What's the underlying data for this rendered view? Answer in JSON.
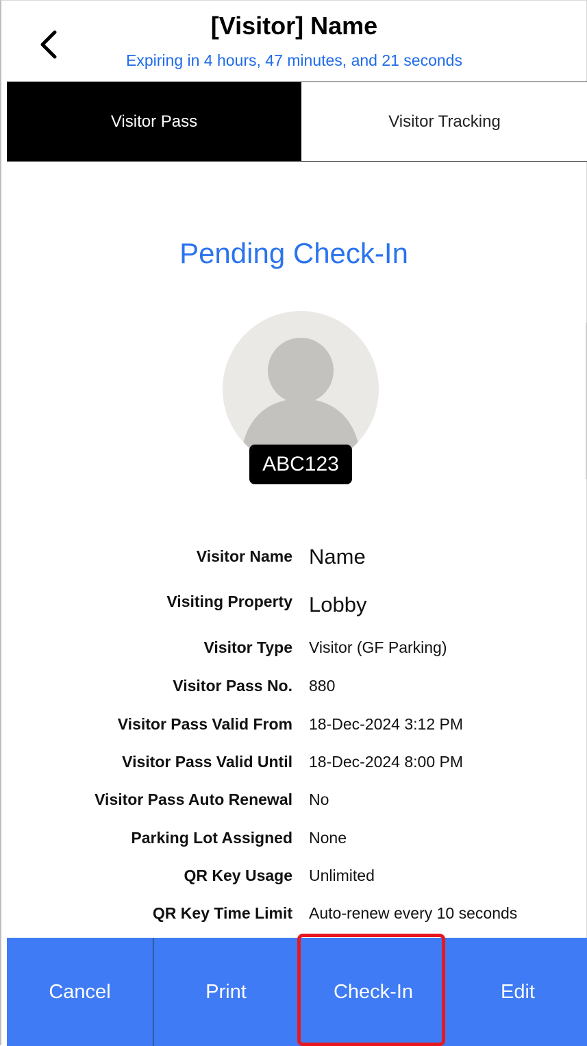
{
  "header": {
    "title": "[Visitor] Name",
    "expiry": "Expiring in 4 hours, 47 minutes, and 21 seconds"
  },
  "tabs": [
    {
      "label": "Visitor Pass",
      "active": true
    },
    {
      "label": "Visitor Tracking",
      "active": false
    }
  ],
  "status": "Pending Check-In",
  "plate": "ABC123",
  "details": [
    {
      "label": "Visitor Name",
      "value": "Name"
    },
    {
      "label": "Visiting Property",
      "value": "Lobby"
    },
    {
      "label": "Visitor Type",
      "value": "Visitor (GF Parking)"
    },
    {
      "label": "Visitor Pass No.",
      "value": "880"
    },
    {
      "label": "Visitor Pass Valid From",
      "value": "18-Dec-2024 3:12 PM"
    },
    {
      "label": "Visitor Pass Valid Until",
      "value": "18-Dec-2024 8:00 PM"
    },
    {
      "label": "Visitor Pass Auto Renewal",
      "value": "No"
    },
    {
      "label": "Parking Lot Assigned",
      "value": "None"
    },
    {
      "label": "QR Key Usage",
      "value": "Unlimited"
    },
    {
      "label": "QR Key Time Limit",
      "value": "Auto-renew every 10 seconds"
    }
  ],
  "actions": {
    "cancel": "Cancel",
    "print": "Print",
    "checkin": "Check-In",
    "edit": "Edit"
  },
  "colors": {
    "accent_blue": "#2b74ee",
    "action_bar": "#3f7bf4",
    "highlight": "#e8181f"
  },
  "icons": {
    "back": "chevron-left-icon",
    "avatar": "person-placeholder-icon"
  }
}
